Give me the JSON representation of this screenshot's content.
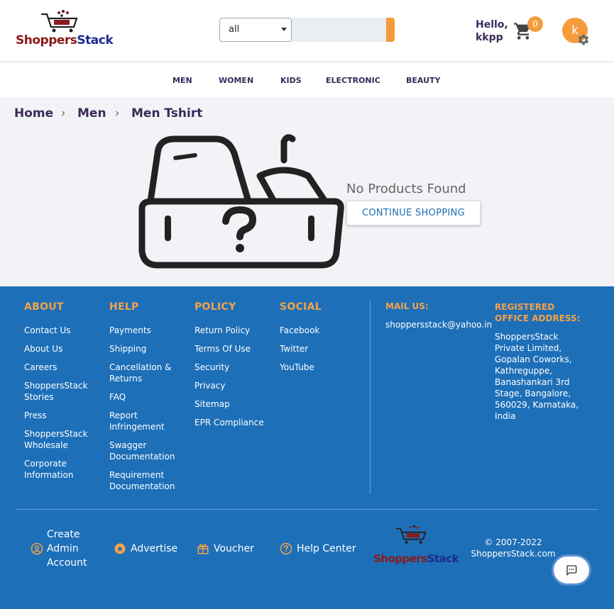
{
  "header": {
    "logo_word_1": "Shoppers",
    "logo_word_2": "Stack",
    "search_category": "all",
    "search_placeholder": "",
    "greeting_line1": "Hello,",
    "greeting_line2": "kkpp",
    "cart_count": "0",
    "avatar_letter": "k"
  },
  "nav": {
    "items": [
      "MEN",
      "WOMEN",
      "KIDS",
      "ELECTRONIC",
      "BEAUTY"
    ]
  },
  "breadcrumb": {
    "items": [
      "Home",
      "Men",
      "Men Tshirt"
    ]
  },
  "main": {
    "empty_title": "No Products Found",
    "continue_label": "CONTINUE SHOPPING"
  },
  "footer": {
    "about": {
      "heading": "ABOUT",
      "links": [
        "Contact Us",
        "About Us",
        "Careers",
        "ShoppersStack Stories",
        "Press",
        "ShoppersStack Wholesale",
        "Corporate Information"
      ]
    },
    "help": {
      "heading": "HELP",
      "links": [
        "Payments",
        "Shipping",
        "Cancellation & Returns",
        "FAQ",
        "Report Infringement",
        "Swagger Documentation",
        "Requirement Documentation"
      ]
    },
    "policy": {
      "heading": "POLICY",
      "links": [
        "Return Policy",
        "Terms Of Use",
        "Security",
        "Privacy",
        "Sitemap",
        "EPR Compliance"
      ]
    },
    "social": {
      "heading": "SOCIAL",
      "links": [
        "Facebook",
        "Twitter",
        "YouTube"
      ]
    },
    "mail": {
      "heading": "MAIL US:",
      "email": "shoppersstack@yahoo.in"
    },
    "address": {
      "heading": "REGISTERED OFFICE ADDRESS:",
      "text": "ShoppersStack Private Limited, Gopalan Coworks, Kathreguppe, Banashankari 3rd Stage, Bangalore, 560029, Karnataka, India"
    },
    "bottom": {
      "create_admin": "Create Admin Account",
      "advertise": "Advertise",
      "voucher": "Voucher",
      "help_center": "Help Center",
      "copyright_line1": "© 2007-2022",
      "copyright_line2": "ShoppersStack.com"
    }
  },
  "colors": {
    "accent": "#f49b3c",
    "footer_bg": "#1d6fb8",
    "footer_heading": "#f4a24a",
    "nav_text": "#3b2a5a"
  }
}
